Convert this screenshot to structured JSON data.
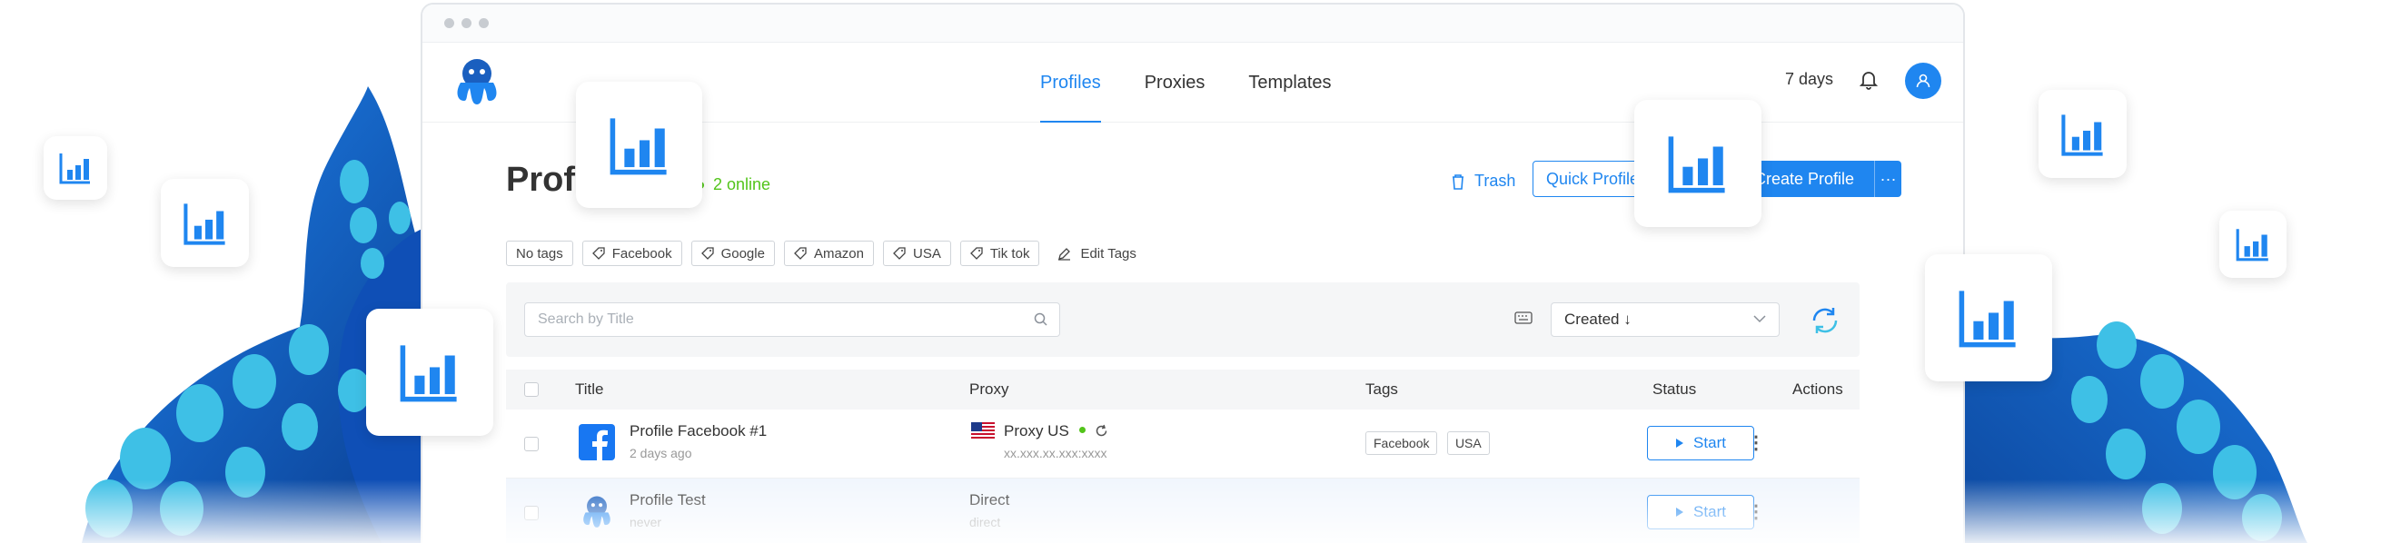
{
  "nav": {
    "tabs": [
      {
        "label": "Profiles",
        "active": true
      },
      {
        "label": "Proxies",
        "active": false
      },
      {
        "label": "Templates",
        "active": false
      }
    ],
    "plan_days": "7 days"
  },
  "header": {
    "title": "Profiles",
    "online": "2 online",
    "trash_label": "Trash",
    "quick_label": "Quick Profile",
    "create_label": "Create Profile",
    "more_label": "···"
  },
  "tags": [
    "No tags",
    "Facebook",
    "Google",
    "Amazon",
    "USA",
    "Tik tok"
  ],
  "edit_tags_label": "Edit Tags",
  "toolbar": {
    "search_placeholder": "Search by Title",
    "sort_label": "Created ↓"
  },
  "table": {
    "columns": [
      "Title",
      "Proxy",
      "Tags",
      "Status",
      "Actions"
    ],
    "rows": [
      {
        "title": "Profile Facebook #1",
        "date": "2 days ago",
        "proxy": "Proxy US",
        "proxy_sub": "xx.xxx.xx.xxx:xxxx",
        "tags": [
          "Facebook",
          "USA"
        ],
        "start": "Start"
      },
      {
        "title": "Profile Test",
        "date": "never",
        "proxy": "Direct",
        "proxy_sub": "direct",
        "tags": [],
        "start": "Start"
      }
    ]
  },
  "colors": {
    "accent": "#1f86f0",
    "online": "#52c41a",
    "tentacle_dark": "#0a3d91",
    "tentacle_mid": "#1a73e8",
    "sucker": "#3ec0e6"
  },
  "icons": [
    "octopus-logo-icon",
    "bell-icon",
    "user-icon",
    "trash-icon",
    "tag-icon",
    "pencil-icon",
    "search-icon",
    "keyboard-icon",
    "chevron-down-icon",
    "refresh-icon",
    "play-icon",
    "facebook-icon",
    "usa-flag-icon",
    "bar-chart-icon"
  ]
}
